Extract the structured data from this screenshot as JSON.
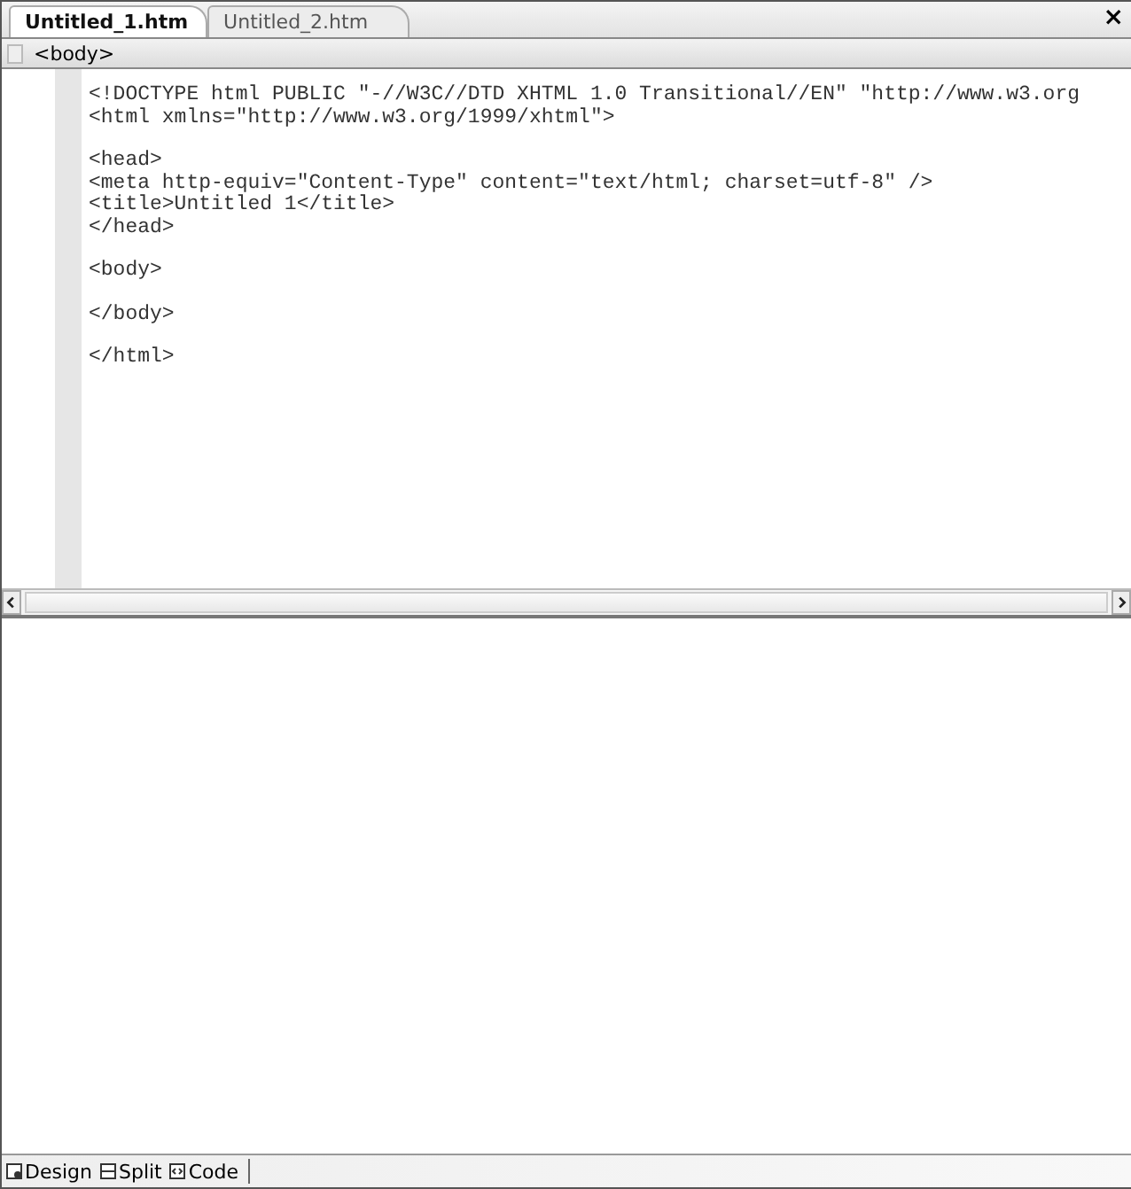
{
  "tabs": [
    {
      "label": "Untitled_1.htm",
      "selected": true
    },
    {
      "label": "Untitled_2.htm",
      "selected": false
    }
  ],
  "close": "×",
  "tag_bar": {
    "tag": "<body>"
  },
  "code_blocks": [
    [
      "<!DOCTYPE html PUBLIC \"-//W3C//DTD XHTML 1.0 Transitional//EN\" \"http://www.w3.org",
      "<html xmlns=\"http://www.w3.org/1999/xhtml\">"
    ],
    [
      "<head>",
      "<meta http-equiv=\"Content-Type\" content=\"text/html; charset=utf-8\" />",
      "<title>Untitled 1</title>",
      "</head>"
    ],
    [
      "<body>"
    ],
    [
      "</body>"
    ],
    [
      "</html>"
    ]
  ],
  "view_buttons": [
    {
      "label": "Design",
      "kind": "design"
    },
    {
      "label": "Split",
      "kind": "split"
    },
    {
      "label": "Code",
      "kind": "code"
    }
  ]
}
